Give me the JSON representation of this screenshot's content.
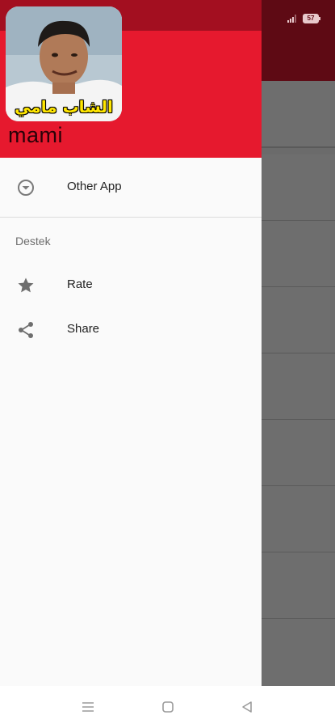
{
  "status_bar": {
    "battery": "57"
  },
  "drawer": {
    "header": {
      "avatar_caption": "الشاب مامي",
      "app_name": "mami"
    },
    "items": [
      {
        "label": "Other App",
        "icon": "dropdown-circle-icon"
      },
      {
        "label": "Rate",
        "icon": "star-icon"
      },
      {
        "label": "Share",
        "icon": "share-icon"
      }
    ],
    "section_title": "Destek"
  },
  "system_nav": {
    "icons": [
      "menu-lines-icon",
      "home-square-icon",
      "back-triangle-icon"
    ]
  },
  "colors": {
    "header_red": "#e6192e",
    "status_dark_red": "#a30f20",
    "scrim_appbar": "#5e0a14",
    "scrim_list": "#6e6e6e"
  }
}
